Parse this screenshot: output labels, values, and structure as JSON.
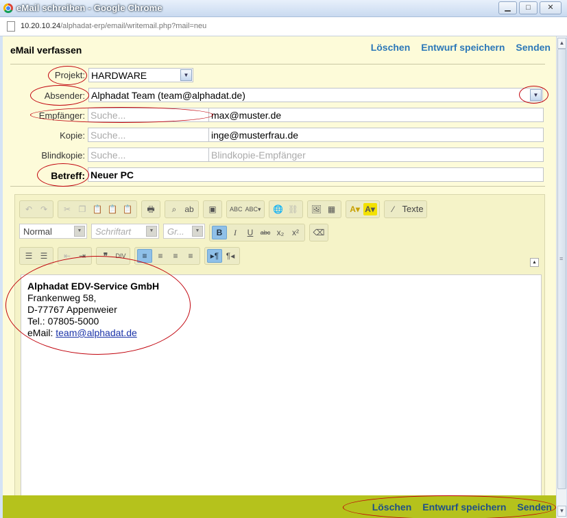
{
  "window": {
    "title": "eMail schreiben - Google Chrome",
    "minimize": "▁",
    "maximize": "□",
    "close": "✕"
  },
  "url": {
    "host": "10.20.10.24",
    "path": "/alphadat-erp/email/writemail.php?mail=neu"
  },
  "header": {
    "title": "eMail verfassen",
    "delete": "Löschen",
    "save_draft": "Entwurf speichern",
    "send": "Senden"
  },
  "form": {
    "project": {
      "label": "Projekt:",
      "value": "HARDWARE"
    },
    "sender": {
      "label": "Absender:",
      "value": "Alphadat Team (team@alphadat.de)"
    },
    "to": {
      "label": "Empfänger:",
      "search_placeholder": "Suche...",
      "value": "max@muster.de"
    },
    "cc": {
      "label": "Kopie:",
      "search_placeholder": "Suche...",
      "value": "inge@musterfrau.de"
    },
    "bcc": {
      "label": "Blindkopie:",
      "search_placeholder": "Suche...",
      "placeholder": "Blindkopie-Empfänger"
    },
    "subject": {
      "label": "Betreff:",
      "value": "Neuer PC"
    }
  },
  "editor": {
    "format": "Normal",
    "font": "Schriftart",
    "size": "Gr...",
    "texte": "Texte",
    "signature": {
      "company": "Alphadat EDV-Service GmbH",
      "street": "Frankenweg 58,",
      "city": "D-77767 Appenweier",
      "phone": "Tel.: 07805-5000",
      "email_label": "eMail:",
      "email": "team@alphadat.de"
    }
  },
  "footer": {
    "delete": "Löschen",
    "save_draft": "Entwurf speichern",
    "send": "Senden"
  },
  "colors": {
    "link": "#2b77b8",
    "footer": "#b5c21c",
    "background": "#fdfbd9",
    "annotation": "#c0000a"
  }
}
